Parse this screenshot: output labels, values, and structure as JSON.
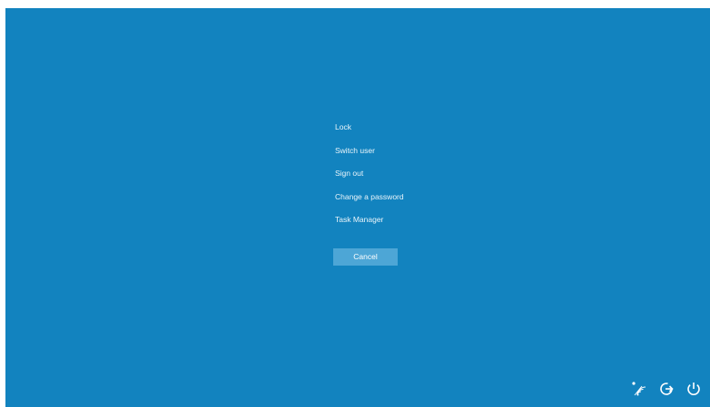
{
  "colors": {
    "background": "#1283bf",
    "cancel_button": "#4da6d6",
    "text": "#ffffff"
  },
  "menu": {
    "items": [
      {
        "label": "Lock"
      },
      {
        "label": "Switch user"
      },
      {
        "label": "Sign out"
      },
      {
        "label": "Change a password"
      },
      {
        "label": "Task Manager"
      }
    ]
  },
  "cancel_label": "Cancel",
  "tray": {
    "icons": [
      "network-icon",
      "ease-of-access-icon",
      "power-icon"
    ]
  }
}
